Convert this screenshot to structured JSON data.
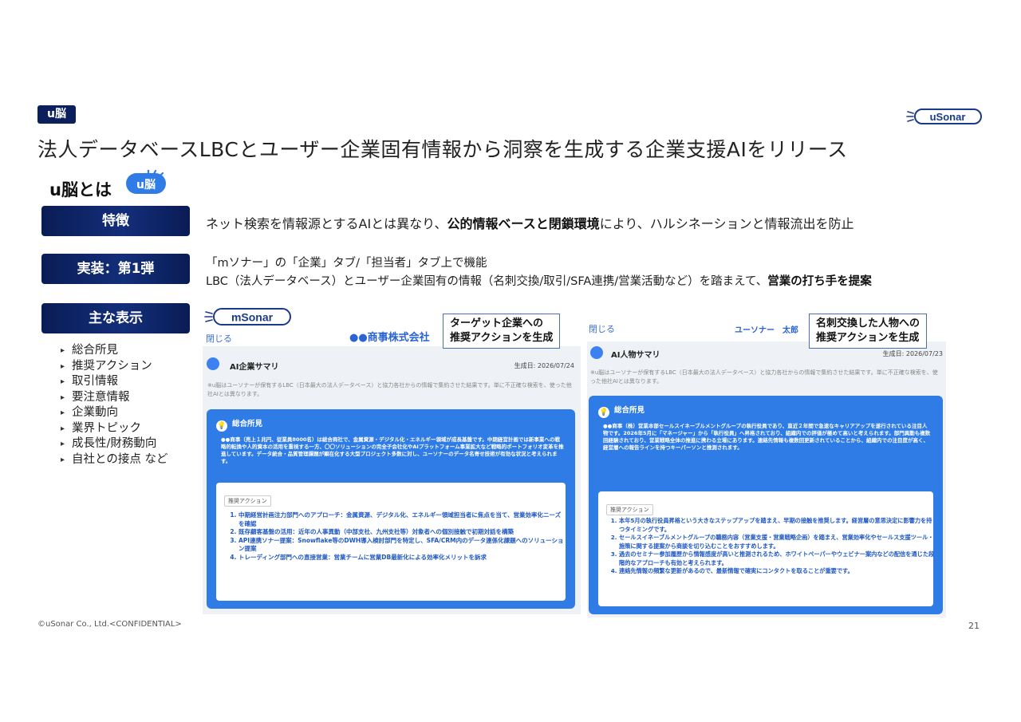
{
  "header": {
    "badge": "u脳",
    "title": "法人データベースLBCとユーザー企業固有情報から洞察を生成する企業支援AIをリリース",
    "logo_text": "uSonar"
  },
  "section": {
    "title": "u脳とは",
    "badge_text": "u脳"
  },
  "rows": {
    "feature": {
      "label": "特徴",
      "text_pre": "ネット検索を情報源とするAIとは異なり、",
      "text_bold": "公的情報ベースと閉鎖環境",
      "text_post": "により、ハルシネーションと情報流出を防止"
    },
    "impl": {
      "label": "実装：第1弾",
      "line1": "「mソナー」の「企業」タブ/「担当者」タブ上で機能",
      "line2_pre": "LBC（法人データベース）とユーザー企業固有の情報（名刺交換/取引/SFA連携/営業活動など）を踏まえて、",
      "line2_bold": "営業の打ち手を提案"
    },
    "display": {
      "label": "主な表示",
      "items": [
        "総合所見",
        "推奨アクション",
        "取引情報",
        "要注意情報",
        "企業動向",
        "業界トピック",
        "成長性/財務動向",
        "自社との接点 など"
      ]
    }
  },
  "left_panel": {
    "logo_text": "mSonar",
    "close": "閉じる",
    "company": "●●商事株式会社",
    "callout": [
      "ターゲット企業への",
      "推奨アクションを生成"
    ],
    "summary_title": "AI企業サマリ",
    "summary_date": "生成日: 2026/07/24",
    "disclaimer": "※u脳はユーソナーが保有するLBC（日本最大の法人データベース）と協力各社からの情報で集約させた結果です。単に不正確な検索を、使った他社AIとは異なります。",
    "overview_title": "総合所見",
    "overview_body": "●●商事（売上１兆円、従業員8000名）は総合商社で、金属資源・デジタル化・エネルギー領域が成長基盤です。中期経営計画では新事業への戦略的転換や人的資本の活用を重視する一方、〇〇ソリューションの完全子会社化やAIプラットフォーム事業拡大など戦略的ポートフォリオ変革を推進しています。データ統合・品質管理課題が顕在化する大型プロジェクト多数に対し、ユーソナーのデータ名寄せ技術が有効な状況と考えられます。",
    "actions_tag": "推奨アクション",
    "actions": [
      "中期経営計画注力部門へのアプローチ：金属資源、デジタル化、エネルギー領域担当者に焦点を当て、営業効率化ニーズを確認",
      "既存顧客基盤の活用：近年の人事異動（中部支社、九州支社等）対象者への個別接触で初期対話を構築",
      "API連携ソナー提案：Snowflake等のDWH導入検討部門を特定し、SFA/CRM内のデータ連係化課題へのソリューション提案",
      "トレーディング部門への直接営業：営業チームに営業DB最新化による効率化メリットを訴求"
    ]
  },
  "right_panel": {
    "close": "閉じる",
    "user": "ユーソナー　太郎",
    "callout": [
      "名刺交換した人物への",
      "推奨アクションを生成"
    ],
    "summary_title": "AI人物サマリ",
    "summary_date": "生成日: 2026/07/23",
    "disclaimer": "※u脳はユーソナーが保有するLBC（日本最大の法人データベース）と協力各社からの情報で集約させた結果です。単に不正確な検索を、使った他社AIとは異なります。",
    "overview_title": "総合所見",
    "overview_body": "●●商事（株）営業本部セールスイネーブルメントグループの執行役員であり、直近２年間で急速なキャリアアップを遂行されている注目人物です。2026年5月に「マネージャー」から「執行役員」へ昇格されており、組織内での評価が極めて高いと考えられます。部門異動も複数回経験されており、営業戦略全体の推進に携わる立場にあります。連絡先情報も複数回更新されていることから、組織内での注目度が高く、経営層への報告ラインを持つキーパーソンと推測されます。",
    "actions_tag": "推奨アクション",
    "actions": [
      "本年5月の執行役員昇格という大きなステップアップを踏まえ、早期の接触を推奨します。経営層の意思決定に影響力を持つタイミングです。",
      "セールスイネーブルメントグループの職務内容（営業支援・営業戦略企画）を踏まえ、営業効率化やセールス支援ツール・施策に関する提案から商談を切り込むことをおすすめします。",
      "過去のセミナー参加履歴から情報感度が高いと推測されるため、ホワイトペーパーやウェビナー案内などの配信を通じた段階的なアプローチも有効と考えられます。",
      "連絡先情報の頻繁な更新があるので、最新情報で確実にコンタクトを取ることが重要です。"
    ]
  },
  "footer": {
    "copyright": "©uSonar Co., Ltd.<CONFIDENTIAL>",
    "page": "21"
  },
  "colors": {
    "navy": "#0b1f5c",
    "accent_blue": "#2f7ce6",
    "link_blue": "#2a63d4"
  }
}
